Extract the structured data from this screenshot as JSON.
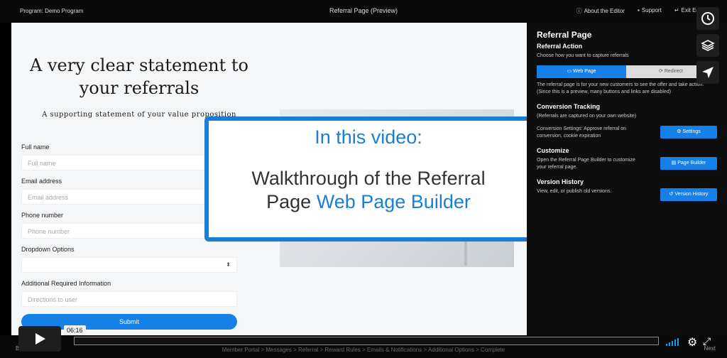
{
  "topbar": {
    "program": "Program: Demo Program",
    "title": "Referral Page (Preview)",
    "about": "About the Editor",
    "support": "Support",
    "exit": "Exit Editor"
  },
  "hero": {
    "headline_line1": "A very clear statement to",
    "headline_line2": "your referrals",
    "subheadline": "A supporting statement of your value proposition"
  },
  "form": {
    "full_name_label": "Full name",
    "full_name_placeholder": "Full name",
    "email_label": "Email address",
    "email_placeholder": "Email address",
    "phone_label": "Phone number",
    "phone_placeholder": "Phone number",
    "dropdown_label": "Dropdown Options",
    "additional_label": "Additional Required Information",
    "additional_placeholder": "Directions to user",
    "submit_label": "Submit"
  },
  "overlay": {
    "title": "In this video:",
    "line1": "Walkthrough of the Referral",
    "line2_plain": "Page ",
    "line2_blue": "Web Page Builder"
  },
  "panel": {
    "heading": "Referral Page",
    "action_title": "Referral Action",
    "action_desc": "Choose how you want to capture referrals",
    "web_page": "Web Page",
    "redirect": "Redirect",
    "web_page_desc": "The referral page is for your new customers to see the offer and take action. (Since this is a preview, many buttons and links are disabled)",
    "tracking_title": "Conversion Tracking",
    "tracking_desc": "(Referrals are captured on your own website)",
    "tracking_settings_desc": "Conversion Settings: Approve referral on conversion, cookie expiration",
    "settings_btn": "Settings",
    "customize_title": "Customize",
    "customize_desc": "Open the Referral Page Builder to customize your referral page.",
    "page_builder_btn": "Page Builder",
    "history_title": "Version History",
    "history_desc": "View, edit, or publish old versions.",
    "history_btn": "Version History"
  },
  "bottomnav": {
    "back": "Back",
    "next": "Next",
    "crumbs": "Member Portal  >  Messages  >  Referral  >  Reward Rules  >  Emails & Notifications  >  Additional Options  >  Complete"
  },
  "player": {
    "time": "06:16"
  },
  "icons": [
    "clock-icon",
    "layers-icon",
    "send-icon",
    "play-icon",
    "volume-icon",
    "gear-icon",
    "fullscreen-icon"
  ],
  "colors": {
    "accent": "#1581e8",
    "overlay_border": "#1a7fd4"
  }
}
